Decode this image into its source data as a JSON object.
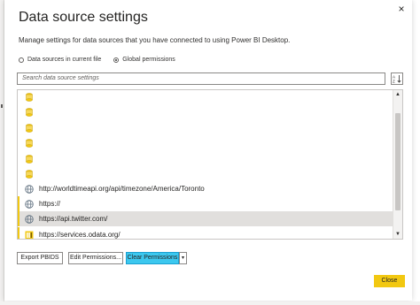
{
  "dialog": {
    "title": "Data source settings",
    "subtitle": "Manage settings for data sources that you have connected to using Power BI Desktop.",
    "close_glyph": "×"
  },
  "scope": {
    "options": [
      {
        "label": "Data sources in current file",
        "selected": false
      },
      {
        "label": "Global permissions",
        "selected": true
      }
    ]
  },
  "search": {
    "placeholder": "Search data source settings"
  },
  "sources": [
    {
      "icon": "database-icon",
      "label": ""
    },
    {
      "icon": "database-icon",
      "label": ""
    },
    {
      "icon": "database-icon",
      "label": ""
    },
    {
      "icon": "database-icon",
      "label": ""
    },
    {
      "icon": "database-icon",
      "label": ""
    },
    {
      "icon": "database-icon",
      "label": ""
    },
    {
      "icon": "globe-icon",
      "label": "http://worldtimeapi.org/api/timezone/America/Toronto"
    },
    {
      "icon": "globe-icon",
      "label": "https://"
    },
    {
      "icon": "globe-icon",
      "label": "https://api.twitter.com/",
      "selected": true
    },
    {
      "icon": "odata-icon",
      "label": "https://services.odata.org/"
    }
  ],
  "buttons": {
    "export": "Export PBIDS",
    "edit": "Edit Permissions...",
    "clear": "Clear Permissions",
    "dropdown_glyph": "▾",
    "close": "Close"
  },
  "colors": {
    "accent_yellow": "#f2c811",
    "highlight_cyan": "#3cc8ef",
    "selected_row": "#e1dfdd"
  }
}
